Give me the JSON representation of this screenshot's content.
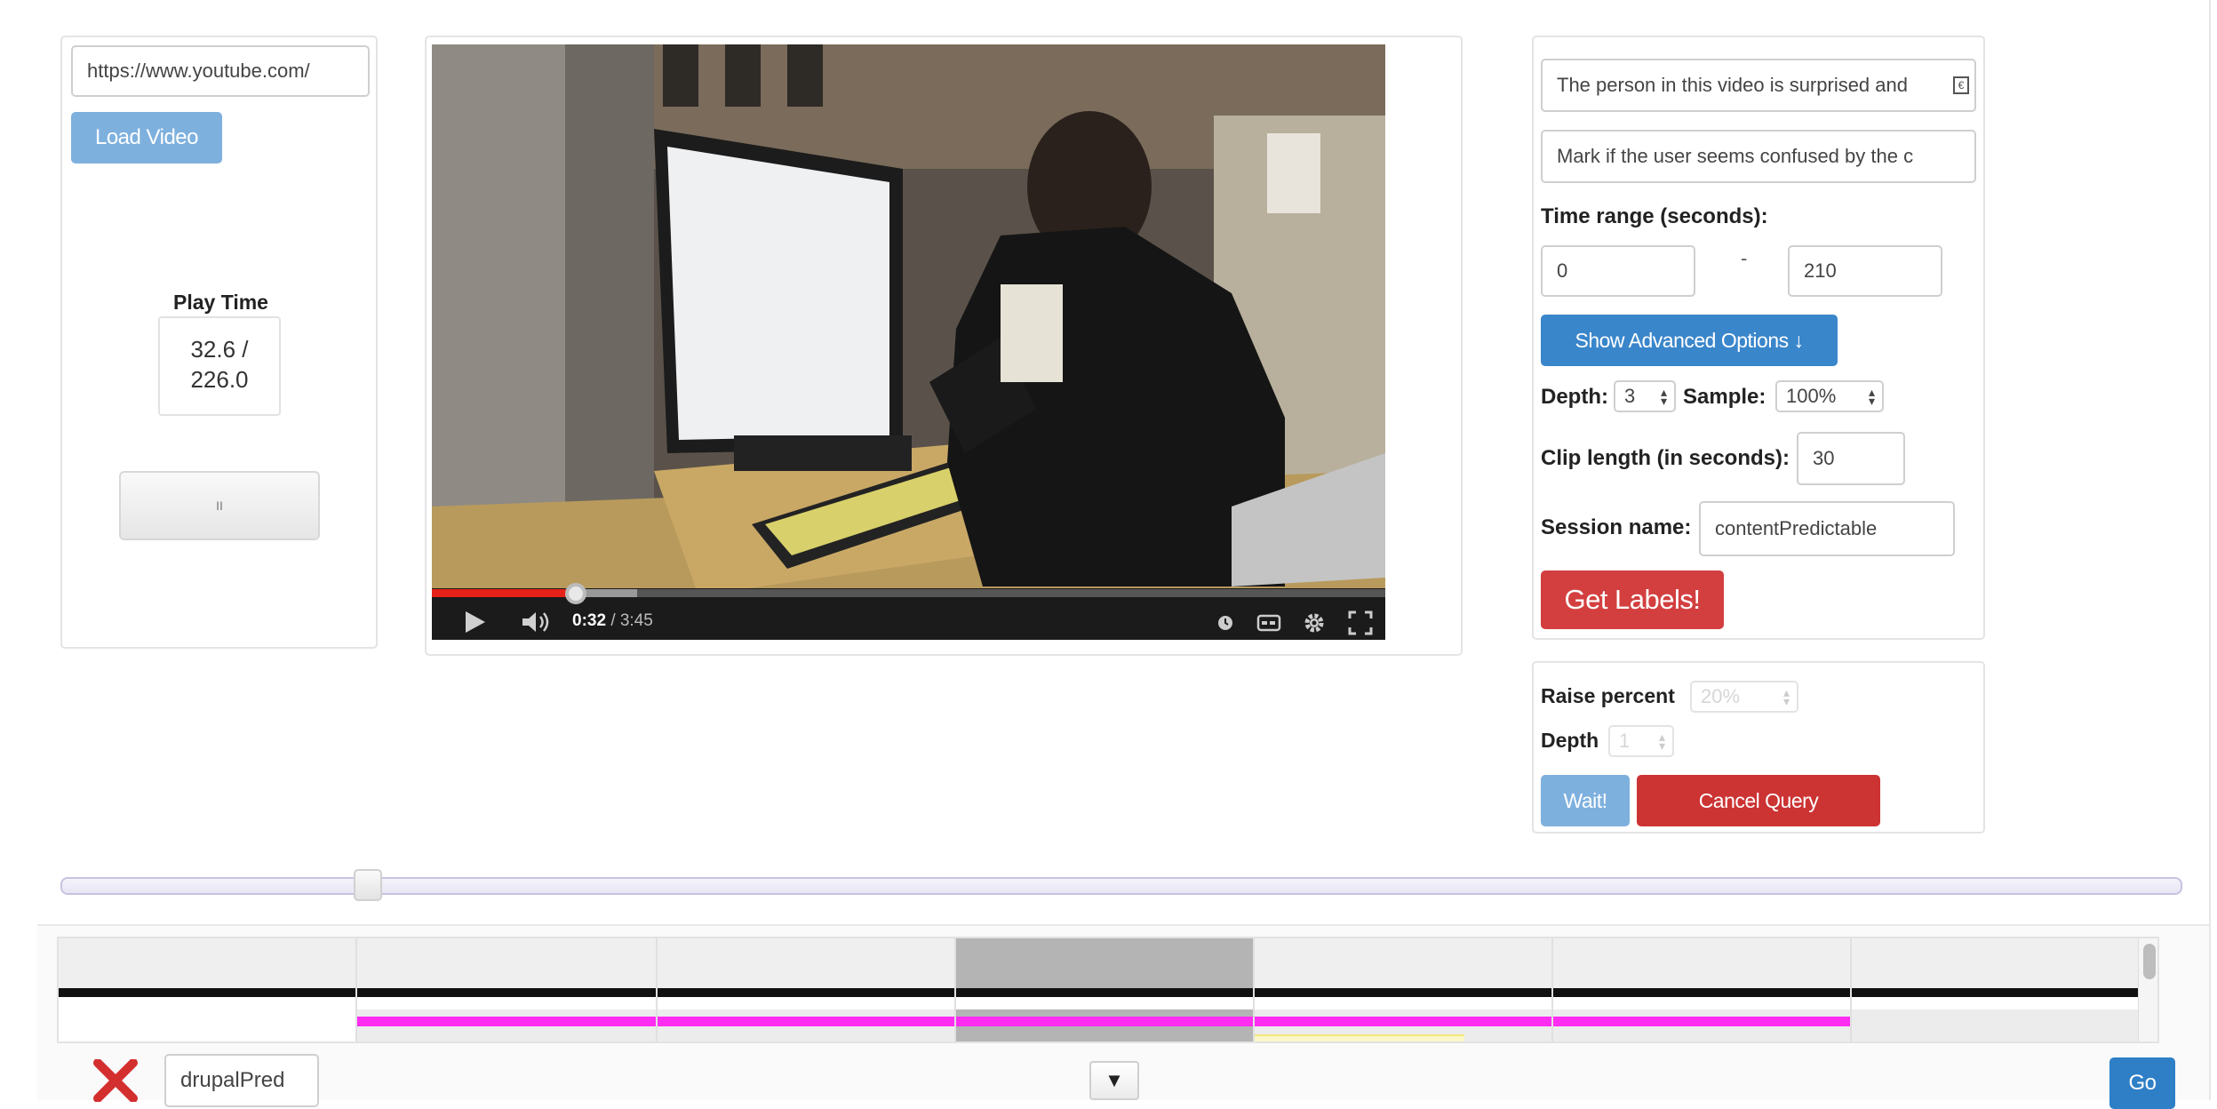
{
  "left_panel": {
    "url_value": "https://www.youtube.com/",
    "load_button": "Load Video",
    "play_time_label": "Play Time",
    "play_time_value": "32.6 /",
    "play_time_total": "226.0",
    "pause_symbol": "II"
  },
  "video": {
    "current_time": "0:32",
    "duration": "/ 3:45",
    "progress_fraction": 0.145,
    "buffered_fraction": 0.215
  },
  "right_panel": {
    "question_value": "The person in this video is surprised and",
    "instruction_value": "Mark if the user seems confused by the c",
    "time_range_label": "Time range (seconds):",
    "time_from": "0",
    "time_sep": "-",
    "time_to": "210",
    "advanced_button": "Show Advanced Options ↓",
    "depth_label": "Depth:",
    "depth_value": "3",
    "sample_label": "Sample:",
    "sample_value": "100%",
    "clip_label": "Clip length (in seconds):",
    "clip_value": "30",
    "session_label": "Session name:",
    "session_value": "contentPredictable",
    "get_labels_button": "Get Labels!"
  },
  "query_panel": {
    "raise_label": "Raise percent",
    "raise_value": "20%",
    "depth_label": "Depth",
    "depth_value": "1",
    "wait_button": "Wait!",
    "cancel_button": "Cancel Query"
  },
  "slider": {
    "value_fraction": 0.145
  },
  "bottom_bar": {
    "session_input": "drupalPred",
    "dropdown_symbol": "▼",
    "go_button": "Go"
  },
  "colors": {
    "blue_light": "#7eb0de",
    "blue": "#3a86cb",
    "red": "#d33f3f",
    "magenta": "#ff2cf2",
    "youtube_red": "#e62117"
  },
  "icons": [
    "delete-x-icon",
    "play-icon",
    "volume-icon",
    "clock-icon",
    "captions-icon",
    "settings-gear-icon",
    "fullscreen-icon"
  ]
}
